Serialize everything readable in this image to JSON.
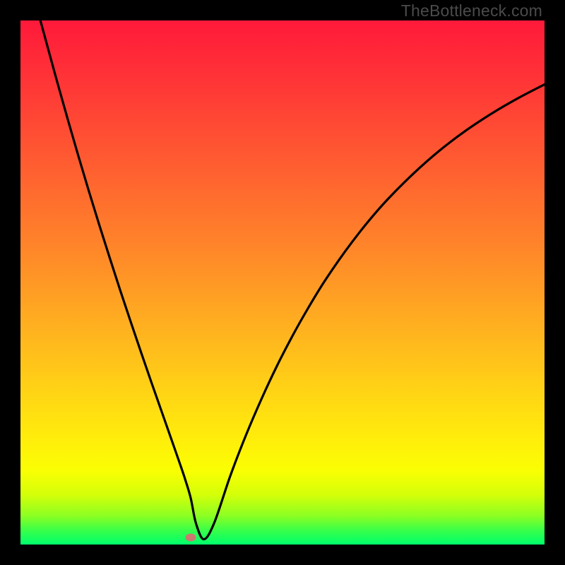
{
  "watermark": "TheBottleneck.com",
  "chart_data": {
    "type": "line",
    "title": "",
    "xlabel": "",
    "ylabel": "",
    "xlim": [
      0,
      100
    ],
    "ylim": [
      0,
      100
    ],
    "marker": {
      "x": 32.5,
      "y": 1.3,
      "color": "#cd7870"
    },
    "gradient_stops": [
      {
        "offset": 0.0,
        "color": "#ff193a"
      },
      {
        "offset": 0.145,
        "color": "#ff3c36"
      },
      {
        "offset": 0.29,
        "color": "#ff6130"
      },
      {
        "offset": 0.44,
        "color": "#ff8729"
      },
      {
        "offset": 0.58,
        "color": "#ffaf20"
      },
      {
        "offset": 0.72,
        "color": "#ffd714"
      },
      {
        "offset": 0.805,
        "color": "#ffef0a"
      },
      {
        "offset": 0.86,
        "color": "#faff03"
      },
      {
        "offset": 0.905,
        "color": "#d4ff09"
      },
      {
        "offset": 0.945,
        "color": "#8cff22"
      },
      {
        "offset": 0.975,
        "color": "#33ff4c"
      },
      {
        "offset": 1.0,
        "color": "#00ff6c"
      }
    ],
    "series": [
      {
        "name": "bottleneck-curve",
        "x": [
          3.8,
          5,
          7,
          9,
          11,
          13,
          15,
          17,
          19,
          21,
          23,
          25,
          27,
          29,
          30.5,
          31.5,
          32.5,
          33.5,
          35,
          37,
          40,
          43,
          46,
          49,
          52,
          55,
          58,
          62,
          66,
          70,
          75,
          80,
          85,
          90,
          95,
          100
        ],
        "y": [
          100,
          95.6,
          88.3,
          81.2,
          74.3,
          67.6,
          61.1,
          54.8,
          48.6,
          42.6,
          36.7,
          30.9,
          25.2,
          19.5,
          15.2,
          12.2,
          8.8,
          4.0,
          1.0,
          4.2,
          13.0,
          20.8,
          27.8,
          34.2,
          40.0,
          45.3,
          50.2,
          56.0,
          61.2,
          65.8,
          70.8,
          75.2,
          79.0,
          82.3,
          85.2,
          87.8
        ]
      }
    ]
  }
}
